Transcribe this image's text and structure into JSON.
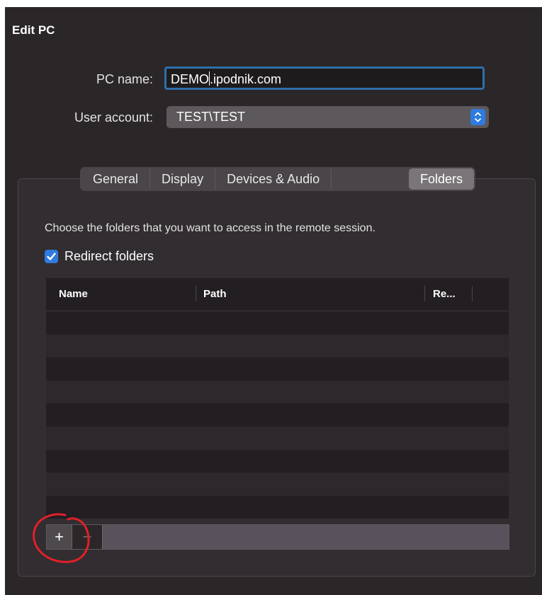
{
  "dialog": {
    "title": "Edit PC"
  },
  "form": {
    "pc_name_label": "PC name:",
    "pc_name_value": "DEMO",
    "pc_name_value_rest": ".ipodnik.com",
    "user_account_label": "User account:",
    "user_account_value": "TEST\\TEST"
  },
  "tabs": [
    {
      "label": "General"
    },
    {
      "label": "Display"
    },
    {
      "label": "Devices & Audio"
    },
    {
      "label": "Folders",
      "active": true
    }
  ],
  "folders": {
    "description": "Choose the folders that you want to access in the remote session.",
    "redirect_label": "Redirect folders",
    "redirect_checked": true,
    "columns": [
      "Name",
      "Path",
      "Re..."
    ],
    "rows": [],
    "add_symbol": "+",
    "remove_symbol": "−"
  },
  "colors": {
    "accent": "#2f7be0",
    "focus_ring": "#2e6fa8",
    "annotation": "#e0202a",
    "window_bg": "#2b2729"
  }
}
